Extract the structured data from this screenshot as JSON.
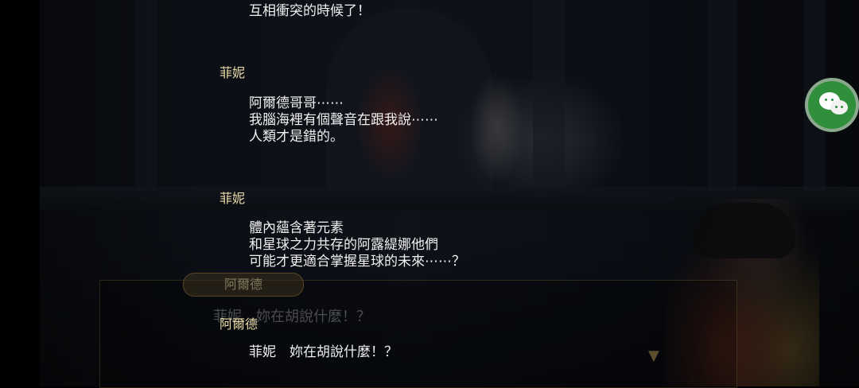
{
  "dialogue_log": [
    {
      "speaker": "",
      "lines": [
        "互相衝突的時候了！"
      ]
    },
    {
      "speaker": "菲妮",
      "lines": [
        "阿爾德哥哥⋯⋯",
        "我腦海裡有個聲音在跟我說⋯⋯",
        "人類才是錯的。"
      ]
    },
    {
      "speaker": "菲妮",
      "lines": [
        "體內蘊含著元素",
        "和星球之力共存的阿露緹娜他們",
        "可能才更適合掌握星球的未來⋯⋯？"
      ]
    },
    {
      "speaker": "阿爾德",
      "lines": [
        "菲妮　妳在胡說什麼！？"
      ]
    }
  ],
  "background_dialog": {
    "name": "阿爾德",
    "text": "菲妮　妳在胡說什麼！？"
  },
  "icons": {
    "share": "wechat-icon",
    "next": "next-arrow-icon"
  },
  "colors": {
    "speaker_name": "#e9d9a6",
    "dialogue_text": "#f0f0f0",
    "wechat_green": "#2f8f3a"
  }
}
